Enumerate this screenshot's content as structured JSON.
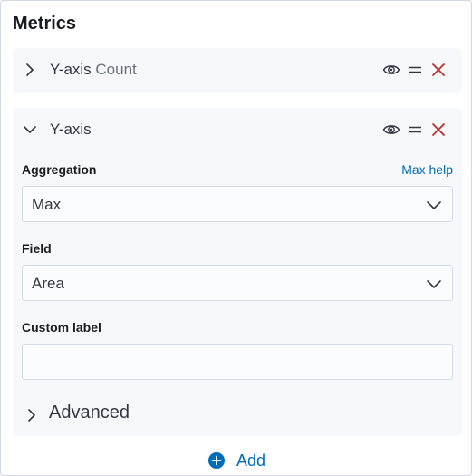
{
  "panel": {
    "title": "Metrics"
  },
  "metrics": [
    {
      "title": "Y-axis",
      "subtitle": "Count",
      "expanded": false,
      "icons": [
        "eye-icon",
        "drag-handle-icon",
        "close-icon"
      ]
    },
    {
      "title": "Y-axis",
      "expanded": true,
      "icons": [
        "eye-icon",
        "drag-handle-icon",
        "close-icon"
      ],
      "aggregation": {
        "label": "Aggregation",
        "help_link": "Max help",
        "value": "Max"
      },
      "field": {
        "label": "Field",
        "value": "Area"
      },
      "custom_label": {
        "label": "Custom label",
        "value": ""
      },
      "advanced_label": "Advanced"
    }
  ],
  "add_button": {
    "label": "Add",
    "icon": "plus-circle-icon"
  },
  "colors": {
    "accent": "#006bb8",
    "danger": "#bd271e",
    "panel_bg": "#f7f8fc",
    "border": "#d3dae6"
  }
}
